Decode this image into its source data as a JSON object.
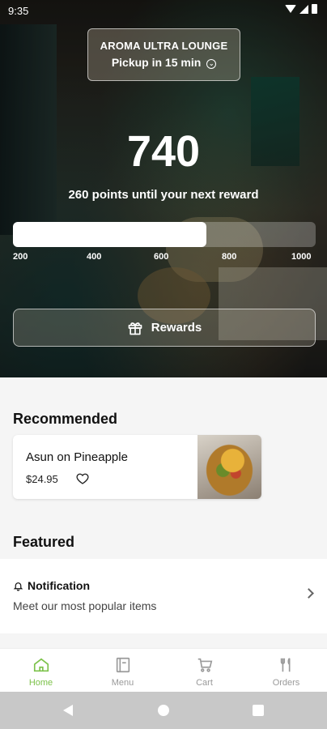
{
  "status_bar": {
    "time": "9:35"
  },
  "store": {
    "name": "AROMA ULTRA LOUNGE",
    "pickup": "Pickup in 15 min"
  },
  "rewards": {
    "points": "740",
    "subtitle": "260 points until your next reward",
    "progress_fraction": 0.64,
    "ticks": [
      "200",
      "400",
      "600",
      "800",
      "1000"
    ],
    "button_label": "Rewards"
  },
  "recommended": {
    "title": "Recommended",
    "items": [
      {
        "name": "Asun on Pineapple",
        "price": "$24.95"
      }
    ]
  },
  "featured": {
    "title": "Featured",
    "notification_title": "Notification",
    "notification_subtitle": "Meet our most popular items"
  },
  "nav": {
    "items": [
      {
        "label": "Home",
        "icon": "home-icon",
        "active": true
      },
      {
        "label": "Menu",
        "icon": "menu-icon",
        "active": false
      },
      {
        "label": "Cart",
        "icon": "cart-icon",
        "active": false
      },
      {
        "label": "Orders",
        "icon": "orders-icon",
        "active": false
      }
    ]
  },
  "colors": {
    "accent": "#7cc24a",
    "inactive": "#9a9a9a"
  }
}
